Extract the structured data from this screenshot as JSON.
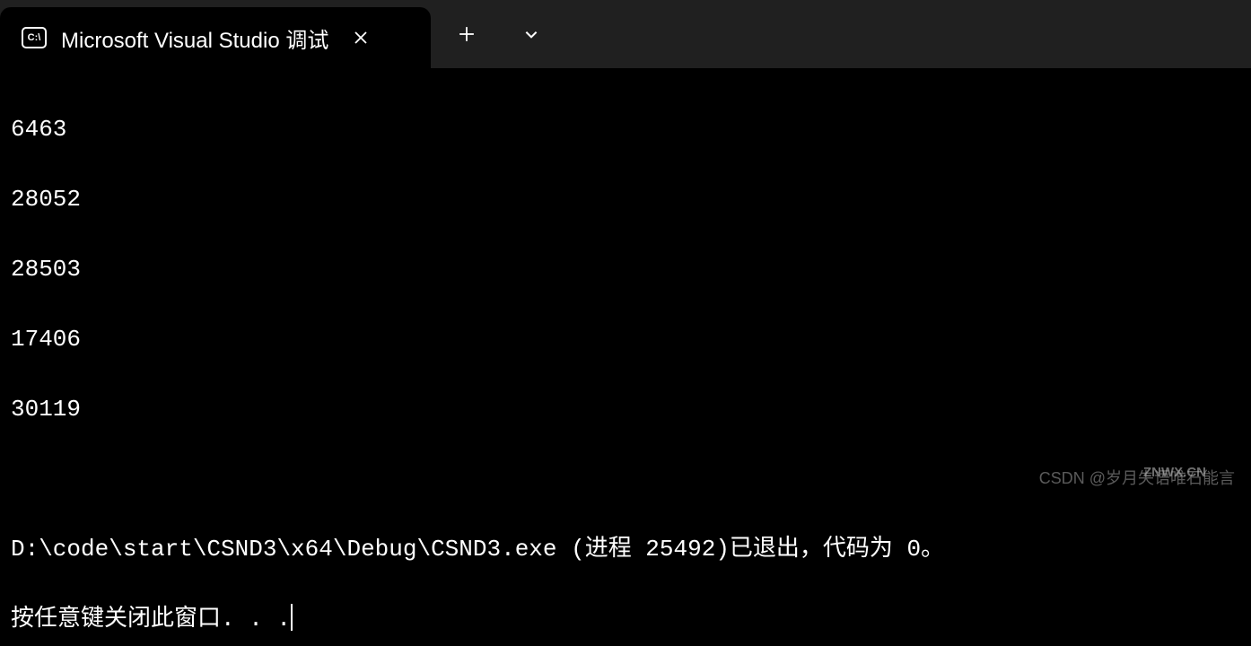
{
  "tab": {
    "title": "Microsoft Visual Studio 调试",
    "icon_label": "C:\\"
  },
  "output": {
    "lines": [
      "6463",
      "28052",
      "28503",
      "17406",
      "30119"
    ],
    "exit_message": "D:\\code\\start\\CSND3\\x64\\Debug\\CSND3.exe (进程 25492)已退出，代码为 0。",
    "prompt_message": "按任意键关闭此窗口. . ."
  },
  "watermark": {
    "text1": "CSDN @岁月失语唯石能言",
    "text2": "ZNWX.CN"
  }
}
